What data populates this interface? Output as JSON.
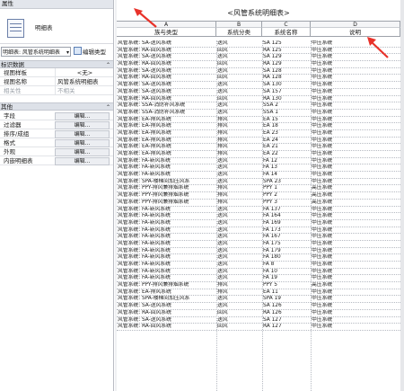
{
  "properties": {
    "header": "属性",
    "type_label": "明细表",
    "type_selector": "明细表: 风管系统明细表",
    "edit_type_label": "编辑类型",
    "sections": [
      {
        "label": "标识数据",
        "rows": [
          {
            "key": "视图样板",
            "value": "<无>",
            "style": "center"
          },
          {
            "key": "视图名称",
            "value": "风管系统明细表",
            "style": "text"
          },
          {
            "key": "相关性",
            "value": "不相关",
            "style": "dim"
          }
        ]
      },
      {
        "label": "其他",
        "rows": [
          {
            "key": "字段",
            "value": "编辑...",
            "style": "button"
          },
          {
            "key": "过滤器",
            "value": "编辑...",
            "style": "button"
          },
          {
            "key": "排序/成组",
            "value": "编辑...",
            "style": "button"
          },
          {
            "key": "格式",
            "value": "编辑...",
            "style": "button"
          },
          {
            "key": "外观",
            "value": "编辑...",
            "style": "button"
          },
          {
            "key": "内嵌明细表",
            "value": "编辑...",
            "style": "button"
          }
        ]
      }
    ]
  },
  "schedule": {
    "title": "<风管系统明细表>",
    "column_letters": [
      "A",
      "B",
      "C",
      "D"
    ],
    "column_headers": [
      "族与类型",
      "系统分类",
      "系统名称",
      "说明"
    ],
    "rows": [
      [
        "风管系统: SA-送风系统",
        "送风",
        "SA 125",
        "中压系统"
      ],
      [
        "风管系统: RA-回风系统",
        "回风",
        "RA 125",
        "中压系统"
      ],
      [
        "风管系统: SA-送风系统",
        "送风",
        "SA 129",
        "中压系统"
      ],
      [
        "风管系统: RA-回风系统",
        "回风",
        "RA 129",
        "中压系统"
      ],
      [
        "风管系统: SA-送风系统",
        "送风",
        "SA 128",
        "中压系统"
      ],
      [
        "风管系统: RA-回风系统",
        "回风",
        "RA 128",
        "中压系统"
      ],
      [
        "风管系统: SA-送风系统",
        "送风",
        "SA 130",
        "中压系统"
      ],
      [
        "风管系统: SA-送风系统",
        "送风",
        "SA 157",
        "中压系统"
      ],
      [
        "风管系统: RA-回风系统",
        "回风",
        "RA 130",
        "中压系统"
      ],
      [
        "风管系统: SSA-消防补风系统",
        "送风",
        "SSA 2",
        "中压系统"
      ],
      [
        "风管系统: SSA-消防补风系统",
        "送风",
        "SSA 1",
        "中压系统"
      ],
      [
        "风管系统: EA-排风系统",
        "排风",
        "EA 15",
        "中压系统"
      ],
      [
        "风管系统: EA-排风系统",
        "排风",
        "EA 18",
        "中压系统"
      ],
      [
        "风管系统: EA-排风系统",
        "排风",
        "EA 23",
        "中压系统"
      ],
      [
        "风管系统: EA-排风系统",
        "排风",
        "EA 24",
        "中压系统"
      ],
      [
        "风管系统: EA-排风系统",
        "排风",
        "EA 21",
        "中压系统"
      ],
      [
        "风管系统: EA-排风系统",
        "排风",
        "EA 22",
        "中压系统"
      ],
      [
        "风管系统: FA-新风系统",
        "送风",
        "FA 12",
        "中压系统"
      ],
      [
        "风管系统: FA-新风系统",
        "送风",
        "FA 13",
        "中压系统"
      ],
      [
        "风管系统: FA-新风系统",
        "送风",
        "FA 14",
        "中压系统"
      ],
      [
        "风管系统: SPA-楼梯间加压风系",
        "送风",
        "SPA 23",
        "中压系统"
      ],
      [
        "风管系统: PPY-排风兼排烟系统",
        "排风",
        "PPY 1",
        "高压系统"
      ],
      [
        "风管系统: PPY-排风兼排烟系统",
        "排风",
        "PPY 2",
        "高压系统"
      ],
      [
        "风管系统: PPY-排风兼排烟系统",
        "排风",
        "PPY 3",
        "高压系统"
      ],
      [
        "风管系统: FA-新风系统",
        "送风",
        "FA 137",
        "中压系统"
      ],
      [
        "风管系统: FA-新风系统",
        "送风",
        "FA 164",
        "中压系统"
      ],
      [
        "风管系统: FA-新风系统",
        "送风",
        "FA 169",
        "中压系统"
      ],
      [
        "风管系统: FA-新风系统",
        "送风",
        "FA 173",
        "中压系统"
      ],
      [
        "风管系统: FA-新风系统",
        "送风",
        "FA 167",
        "中压系统"
      ],
      [
        "风管系统: FA-新风系统",
        "送风",
        "FA 175",
        "中压系统"
      ],
      [
        "风管系统: FA-新风系统",
        "送风",
        "FA 179",
        "中压系统"
      ],
      [
        "风管系统: FA-新风系统",
        "送风",
        "FA 180",
        "中压系统"
      ],
      [
        "风管系统: FA-新风系统",
        "送风",
        "FA 8",
        "中压系统"
      ],
      [
        "风管系统: FA-新风系统",
        "送风",
        "FA 10",
        "中压系统"
      ],
      [
        "风管系统: FA-新风系统",
        "送风",
        "FA 19",
        "中压系统"
      ],
      [
        "风管系统: PPY-排风兼排烟系统",
        "排风",
        "PPY 5",
        "高压系统"
      ],
      [
        "风管系统: EA-排风系统",
        "排风",
        "EA 11",
        "中压系统"
      ],
      [
        "风管系统: SPA-楼梯间加压风系",
        "送风",
        "SPA 19",
        "中压系统"
      ],
      [
        "风管系统: SA-送风系统",
        "送风",
        "SA 126",
        "中压系统"
      ],
      [
        "风管系统: RA-回风系统",
        "回风",
        "RA 126",
        "中压系统"
      ],
      [
        "风管系统: SA-送风系统",
        "送风",
        "SA 127",
        "中压系统"
      ],
      [
        "风管系统: RA-回风系统",
        "回风",
        "RA 127",
        "中压系统"
      ]
    ]
  },
  "colors": {
    "annotation_arrow": "#e8322a"
  }
}
